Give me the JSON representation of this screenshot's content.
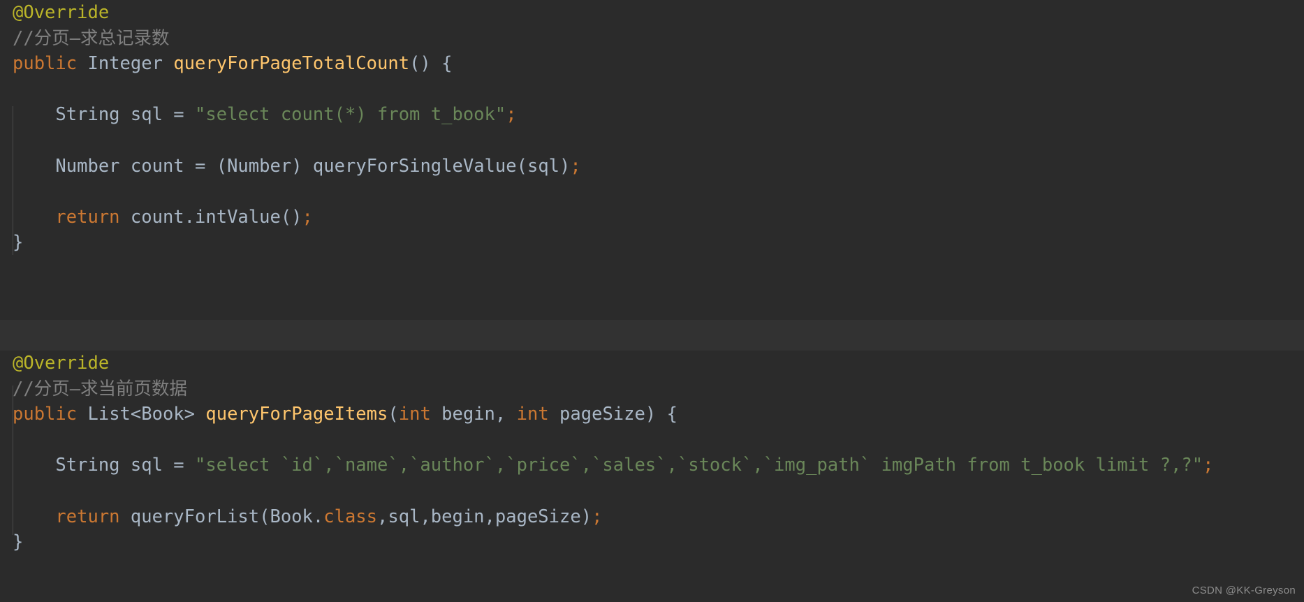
{
  "editor": {
    "theme_name": "darcula",
    "background_color": "#2b2b2b",
    "separator_color": "#323232",
    "default_text_color": "#a9b7c6",
    "indent_guide_color": "#4b4b4b",
    "colors": {
      "annotation": "#bbb529",
      "comment": "#808080",
      "keyword": "#cc7832",
      "method": "#ffc66d",
      "string": "#6a8759",
      "identifier": "#a9b7c6"
    },
    "language": "Java"
  },
  "blocks": [
    {
      "id": "query-for-page-total-count",
      "lines": [
        {
          "id": "line-1",
          "text": "@Override",
          "tokens": [
            {
              "t": "@Override",
              "c": "annotation"
            }
          ]
        },
        {
          "id": "line-2",
          "text": "//分页—求总记录数",
          "tokens": [
            {
              "t": "//分页—求总记录数",
              "c": "comment"
            }
          ]
        },
        {
          "id": "line-3",
          "text": "public Integer queryForPageTotalCount() {",
          "tokens": [
            {
              "t": "public",
              "c": "keyword"
            },
            {
              "t": " ",
              "c": "plain"
            },
            {
              "t": "Integer",
              "c": "type"
            },
            {
              "t": " ",
              "c": "plain"
            },
            {
              "t": "queryForPageTotalCount",
              "c": "method"
            },
            {
              "t": "() {",
              "c": "punct"
            }
          ]
        },
        {
          "id": "line-4",
          "text": "",
          "tokens": []
        },
        {
          "id": "line-5",
          "text": "    String sql = \"select count(*) from t_book\";",
          "tokens": [
            {
              "t": "    ",
              "c": "plain"
            },
            {
              "t": "String",
              "c": "type"
            },
            {
              "t": " sql = ",
              "c": "plain"
            },
            {
              "t": "\"select count(*) from t_book\"",
              "c": "string"
            },
            {
              "t": ";",
              "c": "semi"
            }
          ]
        },
        {
          "id": "line-6",
          "text": "",
          "tokens": []
        },
        {
          "id": "line-7",
          "text": "    Number count = (Number) queryForSingleValue(sql);",
          "tokens": [
            {
              "t": "    ",
              "c": "plain"
            },
            {
              "t": "Number",
              "c": "type"
            },
            {
              "t": " count = (",
              "c": "plain"
            },
            {
              "t": "Number",
              "c": "type"
            },
            {
              "t": ") ",
              "c": "plain"
            },
            {
              "t": "queryForSingleValue",
              "c": "plain"
            },
            {
              "t": "(sql)",
              "c": "plain"
            },
            {
              "t": ";",
              "c": "semi"
            }
          ]
        },
        {
          "id": "line-8",
          "text": "",
          "tokens": []
        },
        {
          "id": "line-9",
          "text": "    return count.intValue();",
          "tokens": [
            {
              "t": "    ",
              "c": "plain"
            },
            {
              "t": "return",
              "c": "keyword"
            },
            {
              "t": " count.intValue()",
              "c": "plain"
            },
            {
              "t": ";",
              "c": "semi"
            }
          ]
        },
        {
          "id": "line-10",
          "text": "}",
          "tokens": [
            {
              "t": "}",
              "c": "punct"
            }
          ]
        }
      ]
    },
    {
      "id": "query-for-page-items",
      "lines": [
        {
          "id": "line-11",
          "text": "@Override",
          "tokens": [
            {
              "t": "@Override",
              "c": "annotation"
            }
          ]
        },
        {
          "id": "line-12",
          "text": "//分页—求当前页数据",
          "tokens": [
            {
              "t": "//分页—求当前页数据",
              "c": "comment"
            }
          ]
        },
        {
          "id": "line-13",
          "text": "public List<Book> queryForPageItems(int begin, int pageSize) {",
          "tokens": [
            {
              "t": "public",
              "c": "keyword"
            },
            {
              "t": " ",
              "c": "plain"
            },
            {
              "t": "List<Book>",
              "c": "type"
            },
            {
              "t": " ",
              "c": "plain"
            },
            {
              "t": "queryForPageItems",
              "c": "method"
            },
            {
              "t": "(",
              "c": "punct"
            },
            {
              "t": "int",
              "c": "keyword"
            },
            {
              "t": " begin, ",
              "c": "plain"
            },
            {
              "t": "int",
              "c": "keyword"
            },
            {
              "t": " pageSize) {",
              "c": "plain"
            }
          ]
        },
        {
          "id": "line-14",
          "text": "",
          "tokens": []
        },
        {
          "id": "line-15",
          "text": "    String sql = \"select `id`,`name`,`author`,`price`,`sales`,`stock`,`img_path` imgPath from t_book limit ?,?\";",
          "tokens": [
            {
              "t": "    ",
              "c": "plain"
            },
            {
              "t": "String",
              "c": "type"
            },
            {
              "t": " sql = ",
              "c": "plain"
            },
            {
              "t": "\"select `id`,`name`,`author`,`price`,`sales`,`stock`,`img_path` imgPath from t_book limit ?,?\"",
              "c": "string"
            },
            {
              "t": ";",
              "c": "semi"
            }
          ]
        },
        {
          "id": "line-16",
          "text": "",
          "tokens": []
        },
        {
          "id": "line-17",
          "text": "    return queryForList(Book.class,sql,begin,pageSize);",
          "tokens": [
            {
              "t": "    ",
              "c": "plain"
            },
            {
              "t": "return",
              "c": "keyword"
            },
            {
              "t": " queryForList(Book.",
              "c": "plain"
            },
            {
              "t": "class",
              "c": "keyword"
            },
            {
              "t": ",sql,begin,pageSize)",
              "c": "plain"
            },
            {
              "t": ";",
              "c": "semi"
            }
          ]
        },
        {
          "id": "line-18",
          "text": "}",
          "tokens": [
            {
              "t": "}",
              "c": "punct"
            }
          ]
        }
      ]
    }
  ],
  "watermark": {
    "text": "CSDN @KK-Greyson"
  }
}
